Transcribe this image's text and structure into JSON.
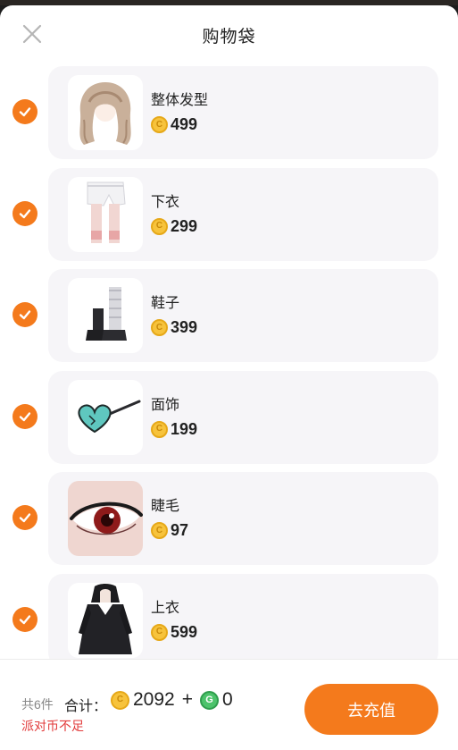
{
  "header": {
    "title": "购物袋"
  },
  "items": [
    {
      "name": "整体发型",
      "price": "499",
      "thumb_icon": "hair-thumbnail-icon"
    },
    {
      "name": "下衣",
      "price": "299",
      "thumb_icon": "pants-thumbnail-icon"
    },
    {
      "name": "鞋子",
      "price": "399",
      "thumb_icon": "shoes-thumbnail-icon"
    },
    {
      "name": "面饰",
      "price": "199",
      "thumb_icon": "face-accessory-thumbnail-icon"
    },
    {
      "name": "睫毛",
      "price": "97",
      "thumb_icon": "eyelash-thumbnail-icon"
    },
    {
      "name": "上衣",
      "price": "599",
      "thumb_icon": "top-thumbnail-icon"
    }
  ],
  "footer": {
    "count_text": "共6件",
    "total_label": "合计：",
    "gold_total": "2092",
    "plus": "+",
    "green_total": "0",
    "warning": "派对币不足",
    "recharge_label": "去充值"
  },
  "colors": {
    "accent": "#f47a1c",
    "warning": "#e23b3b",
    "card_bg": "#f6f5f8"
  }
}
